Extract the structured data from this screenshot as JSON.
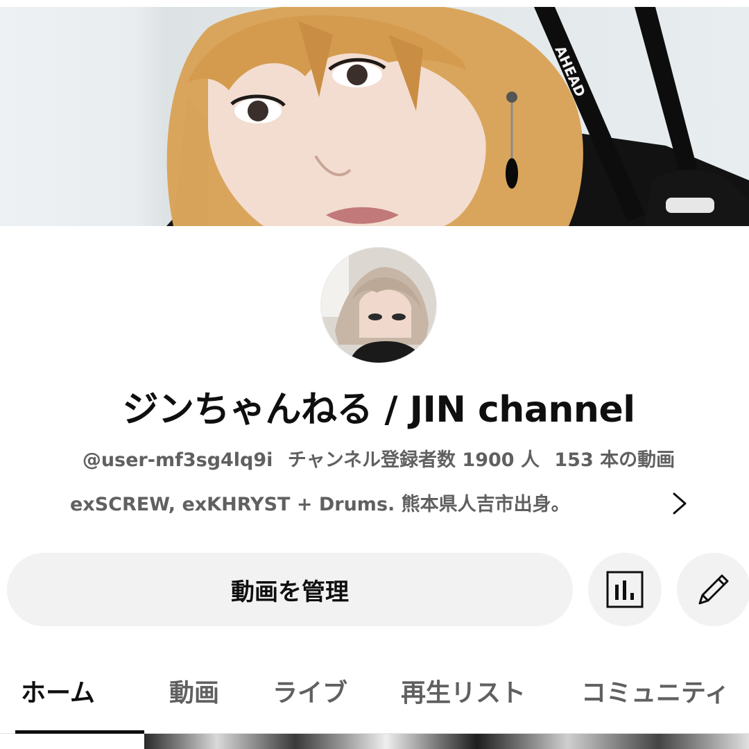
{
  "channel": {
    "name": "ジンちゃんねる / JIN channel",
    "handle": "@user-mf3sg4lq9i",
    "subscribers": "チャンネル登録者数 1900 人",
    "video_count": "153 本の動画",
    "description": "exSCREW, exKHRYST + Drums. 熊本県人吉市出身。"
  },
  "actions": {
    "manage_label": "動画を管理",
    "analytics_icon": "bar-chart-icon",
    "edit_icon": "pencil-icon"
  },
  "tabs": [
    {
      "label": "ホーム",
      "active": true
    },
    {
      "label": "動画",
      "active": false
    },
    {
      "label": "ライブ",
      "active": false
    },
    {
      "label": "再生リスト",
      "active": false
    },
    {
      "label": "コミュニティ",
      "active": false
    }
  ],
  "colors": {
    "text_primary": "#0f0f0f",
    "text_secondary": "#606060",
    "button_bg": "#f2f2f2"
  }
}
